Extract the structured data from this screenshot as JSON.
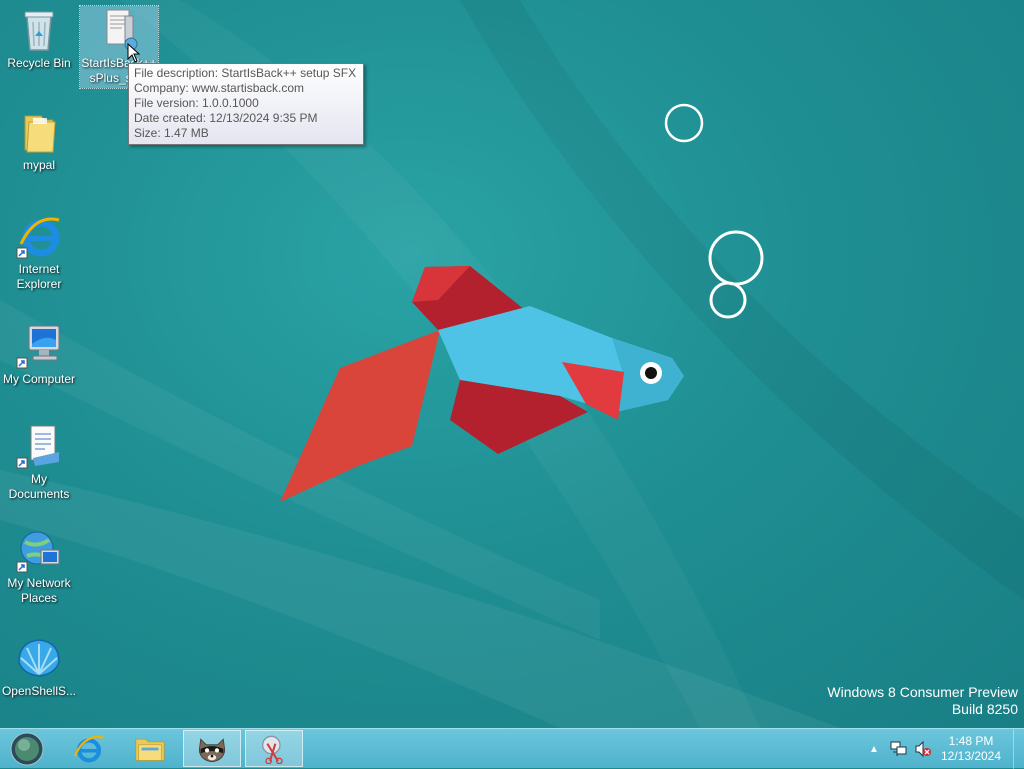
{
  "desktop_icons": [
    {
      "id": "recycle-bin",
      "label": "Recycle Bin"
    },
    {
      "id": "startisback",
      "label": "StartIsBack++ sPlus_se..."
    },
    {
      "id": "mypal",
      "label": "mypal"
    },
    {
      "id": "internet-explorer",
      "label": "Internet Explorer"
    },
    {
      "id": "my-computer",
      "label": "My Computer"
    },
    {
      "id": "my-documents",
      "label": "My Documents"
    },
    {
      "id": "my-network-places",
      "label": "My Network Places"
    },
    {
      "id": "openshell",
      "label": "OpenShellS..."
    }
  ],
  "tooltip": {
    "description": "File description: StartIsBack++ setup SFX",
    "company": "Company: www.startisback.com",
    "version": "File version: 1.0.0.1000",
    "created": "Date created: 12/13/2024 9:35 PM",
    "size": "Size: 1.47 MB"
  },
  "watermark": {
    "line1": "Windows 8 Consumer Preview",
    "line2": "Build 8250"
  },
  "taskbar": {
    "pinned": [
      {
        "icon": "internet-explorer-icon",
        "active": false
      },
      {
        "icon": "file-explorer-icon",
        "active": false
      },
      {
        "icon": "raccoon-app-icon",
        "active": true
      },
      {
        "icon": "snipping-tool-icon",
        "active": true
      }
    ]
  },
  "clock": {
    "time": "1:48 PM",
    "date": "12/13/2024"
  },
  "colors": {
    "desktop": "#1f8f93",
    "taskbar": "#5bbcd4",
    "fish_blue": "#4fc3e6",
    "fish_red": "#b3212f",
    "fish_orange": "#d9453a"
  }
}
